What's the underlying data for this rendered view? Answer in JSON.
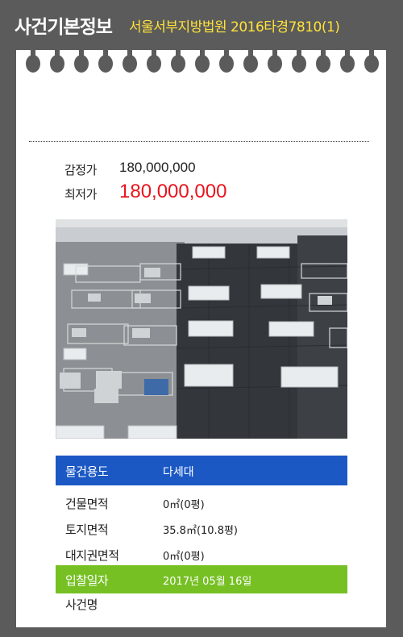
{
  "header": {
    "title": "사건기본정보",
    "case": "서울서부지방법원 2016타경7810(1)"
  },
  "prices": {
    "appraisal_label": "감정가",
    "appraisal_value": "180,000,000",
    "minimum_label": "최저가",
    "minimum_value": "180,000,000"
  },
  "colors": {
    "background": "#5b5b5b",
    "case_text": "#ffe23a",
    "minimum_price": "#e8141c",
    "usage_bar": "#1b58c4",
    "bid_date_bar": "#76c024"
  },
  "details": {
    "usage_label": "물건용도",
    "usage_value": "다세대",
    "building_area_label": "건물면적",
    "building_area_value": "0㎡(0평)",
    "land_area_label": "토지면적",
    "land_area_value": "35.8㎡(10.8평)",
    "land_right_label": "대지권면적",
    "land_right_value": "0㎡(0평)",
    "bid_date_label": "입찰일자",
    "bid_date_value": "2017년 05월 16일",
    "case_name_label": "사건명",
    "case_name_value": ""
  }
}
